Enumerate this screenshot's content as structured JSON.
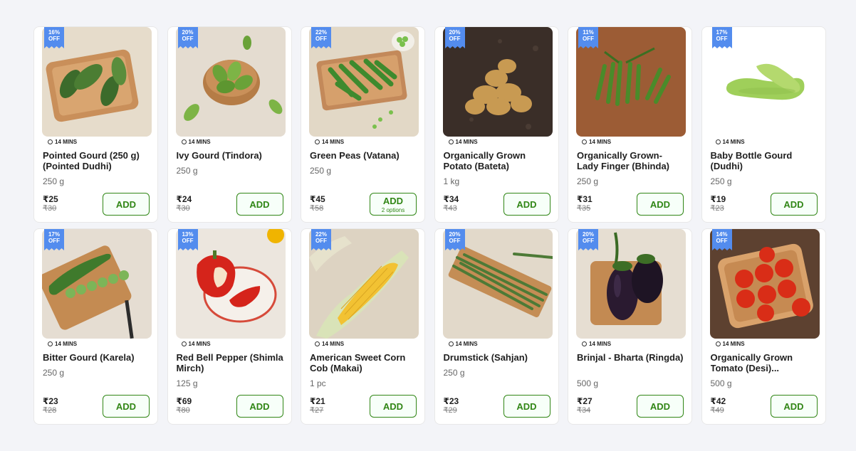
{
  "products": [
    {
      "discount": "16%",
      "off": "OFF",
      "eta": "14 MINS",
      "name": "Pointed Gourd (250 g) (Pointed Dudhi)",
      "qty": "250 g",
      "price": "₹25",
      "mrp": "₹30",
      "add_label": "ADD",
      "options": ""
    },
    {
      "discount": "20%",
      "off": "OFF",
      "eta": "14 MINS",
      "name": "Ivy Gourd (Tindora)",
      "qty": "250 g",
      "price": "₹24",
      "mrp": "₹30",
      "add_label": "ADD",
      "options": ""
    },
    {
      "discount": "22%",
      "off": "OFF",
      "eta": "14 MINS",
      "name": "Green Peas (Vatana)",
      "qty": "250 g",
      "price": "₹45",
      "mrp": "₹58",
      "add_label": "ADD",
      "options": "2 options"
    },
    {
      "discount": "20%",
      "off": "OFF",
      "eta": "14 MINS",
      "name": "Organically Grown Potato (Bateta)",
      "qty": "1 kg",
      "price": "₹34",
      "mrp": "₹43",
      "add_label": "ADD",
      "options": ""
    },
    {
      "discount": "11%",
      "off": "OFF",
      "eta": "14 MINS",
      "name": "Organically Grown- Lady Finger (Bhinda)",
      "qty": "250 g",
      "price": "₹31",
      "mrp": "₹35",
      "add_label": "ADD",
      "options": ""
    },
    {
      "discount": "17%",
      "off": "OFF",
      "eta": "14 MINS",
      "name": "Baby Bottle Gourd (Dudhi)",
      "qty": "250 g",
      "price": "₹19",
      "mrp": "₹23",
      "add_label": "ADD",
      "options": ""
    },
    {
      "discount": "17%",
      "off": "OFF",
      "eta": "14 MINS",
      "name": "Bitter Gourd (Karela)",
      "qty": "250 g",
      "price": "₹23",
      "mrp": "₹28",
      "add_label": "ADD",
      "options": ""
    },
    {
      "discount": "13%",
      "off": "OFF",
      "eta": "14 MINS",
      "name": "Red Bell Pepper (Shimla Mirch)",
      "qty": "125 g",
      "price": "₹69",
      "mrp": "₹80",
      "add_label": "ADD",
      "options": ""
    },
    {
      "discount": "22%",
      "off": "OFF",
      "eta": "14 MINS",
      "name": "American Sweet Corn Cob (Makai)",
      "qty": "1 pc",
      "price": "₹21",
      "mrp": "₹27",
      "add_label": "ADD",
      "options": ""
    },
    {
      "discount": "20%",
      "off": "OFF",
      "eta": "14 MINS",
      "name": "Drumstick (Sahjan)",
      "qty": "250 g",
      "price": "₹23",
      "mrp": "₹29",
      "add_label": "ADD",
      "options": ""
    },
    {
      "discount": "20%",
      "off": "OFF",
      "eta": "14 MINS",
      "name": "Brinjal - Bharta (Ringda)",
      "qty": "500 g",
      "price": "₹27",
      "mrp": "₹34",
      "add_label": "ADD",
      "options": ""
    },
    {
      "discount": "14%",
      "off": "OFF",
      "eta": "14 MINS",
      "name": "Organically Grown Tomato (Desi)...",
      "qty": "500 g",
      "price": "₹42",
      "mrp": "₹49",
      "add_label": "ADD",
      "options": ""
    }
  ],
  "colors": {
    "badge": "#538cee",
    "add_border": "#318616",
    "add_text": "#318616"
  }
}
